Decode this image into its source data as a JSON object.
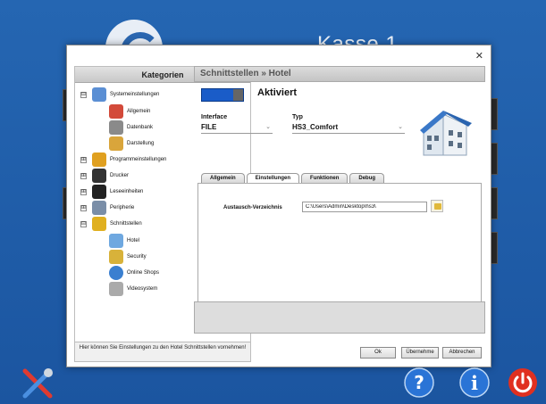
{
  "header": {
    "title": "Kasse 1"
  },
  "dialog": {
    "left": {
      "heading": "Kategorien",
      "tree": [
        {
          "label": "Systemeinstellungen",
          "expander": "⊟",
          "level": 0,
          "icon": "monitor-icon"
        },
        {
          "label": "Allgemein",
          "level": 1,
          "icon": "tools-icon"
        },
        {
          "label": "Datenbank",
          "level": 1,
          "icon": "database-icon"
        },
        {
          "label": "Darstellung",
          "level": 1,
          "icon": "paint-icon"
        },
        {
          "label": "Programmeinstellungen",
          "expander": "⊞",
          "level": 0,
          "icon": "cubes-icon"
        },
        {
          "label": "Drucker",
          "expander": "⊞",
          "level": 0,
          "icon": "printer-icon"
        },
        {
          "label": "Leseeinheiten",
          "expander": "⊞",
          "level": 0,
          "icon": "reader-icon"
        },
        {
          "label": "Peripherie",
          "expander": "⊞",
          "level": 0,
          "icon": "peripheral-icon"
        },
        {
          "label": "Schnittstellen",
          "expander": "⊟",
          "level": 0,
          "icon": "puzzle-icon"
        },
        {
          "label": "Hotel",
          "level": 1,
          "icon": "hotel-icon"
        },
        {
          "label": "Security",
          "level": 1,
          "icon": "safe-icon"
        },
        {
          "label": "Online Shops",
          "level": 1,
          "icon": "globe-icon"
        },
        {
          "label": "Videosystem",
          "level": 1,
          "icon": "camera-icon"
        }
      ],
      "footer": "Hier können Sie Einstellungen zu den Hotel Schnittstellen vornehmen!"
    },
    "right": {
      "heading": "Schnittstellen » Hotel",
      "status": "Aktiviert",
      "interface_label": "Interface",
      "interface_value": "FILE",
      "typ_label": "Typ",
      "typ_value": "HS3_Comfort",
      "tabs": [
        "Allgemein",
        "Einstellungen",
        "Funktionen",
        "Debug"
      ],
      "active_tab": "Einstellungen",
      "field_label": "Austausch-Verzeichnis",
      "field_value": "C:\\Users\\Admin\\Desktop\\hs3\\"
    },
    "buttons": {
      "ok": "Ok",
      "apply": "Übernehme",
      "cancel": "Abbrechen"
    }
  },
  "colors": {
    "background": "#1f5fa8",
    "toggle": "#1a5cc8",
    "power": "#e03020",
    "help": "#2a74d6"
  }
}
